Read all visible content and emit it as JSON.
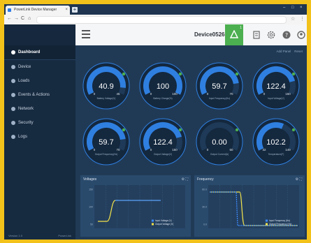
{
  "browser": {
    "tab_title": "PowerLink Device Manager",
    "tab_close": "×",
    "new_tab": "+",
    "back": "←",
    "forward": "→",
    "reload": "C",
    "home": "⌂",
    "star": "☆",
    "menu": "⋮"
  },
  "header": {
    "device_name": "Device0526",
    "alarm_count": "1"
  },
  "sidebar": {
    "items": [
      {
        "label": "Dashboard",
        "active": true
      },
      {
        "label": "Device"
      },
      {
        "label": "Loads"
      },
      {
        "label": "Events & Actions"
      },
      {
        "label": "Network"
      },
      {
        "label": "Security"
      },
      {
        "label": "Logs"
      }
    ],
    "footer_left": "Version 1.0",
    "footer_right": "PowerLink"
  },
  "main": {
    "top_links": [
      "Add Panel",
      "Reset"
    ]
  },
  "gauges": [
    {
      "value": "40.9",
      "min": "0",
      "max": "45",
      "frac": 0.91,
      "label": "Battery Voltage(V)",
      "dot": "#4caf50"
    },
    {
      "value": "100",
      "min": "0",
      "max": "100",
      "frac": 1.0,
      "label": "Battery Charge(%)",
      "dot": "#4caf50"
    },
    {
      "value": "59.7",
      "min": "0",
      "max": "70",
      "frac": 0.85,
      "label": "Input Frequency(Hz)",
      "dot": "#4caf50"
    },
    {
      "value": "122.4",
      "min": "0",
      "max": "150",
      "frac": 0.82,
      "label": "Input Voltage(V)",
      "dot": "#4caf50"
    },
    {
      "value": "59.7",
      "min": "0",
      "max": "70",
      "frac": 0.85,
      "label": "Output Frequency(Hz)",
      "dot": "#4caf50"
    },
    {
      "value": "122.4",
      "min": "0",
      "max": "150",
      "frac": 0.82,
      "label": "Output Voltage(V)",
      "dot": "#4caf50"
    },
    {
      "value": "0.00",
      "min": "0",
      "max": "50",
      "frac": 0.0,
      "label": "Output Current(A)",
      "dot": "#4caf50"
    },
    {
      "value": "102.2",
      "min": "32",
      "max": "149",
      "frac": 0.6,
      "label": "Temperature(F)",
      "dot": "#4caf50"
    }
  ],
  "charts": [
    {
      "title": "Voltages",
      "icons": "⚙ ⛶",
      "y_ticks": [
        "150",
        "100",
        "50"
      ],
      "legend": [
        "Input Voltage (V)",
        "Output Voltage (V)"
      ]
    },
    {
      "title": "Frequency",
      "icons": "⚙ ⛶",
      "y_ticks": [
        "60.0",
        "30.0",
        "0.0"
      ],
      "legend": [
        "Input Frequency (Hz)",
        "Output Frequency (Hz)"
      ]
    }
  ],
  "colors": {
    "accent_green": "#4caf50",
    "gauge_blue": "#2f7fe0",
    "series_yellow": "#f3e34a",
    "series_blue": "#3d8bff"
  }
}
